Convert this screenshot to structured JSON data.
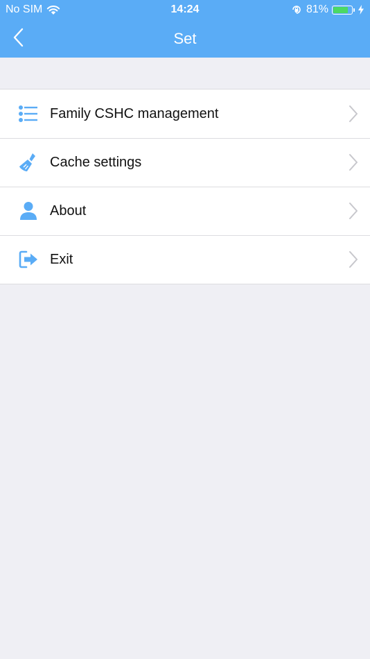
{
  "status_bar": {
    "carrier": "No SIM",
    "time": "14:24",
    "battery_percent": "81%",
    "battery_level": 0.81,
    "icons": [
      "wifi-icon",
      "orientation-lock-icon",
      "battery-icon",
      "charging-icon"
    ]
  },
  "nav": {
    "title": "Set",
    "back_icon": "chevron-left-icon"
  },
  "menu": {
    "items": [
      {
        "label": "Family CSHC management",
        "icon": "list-icon"
      },
      {
        "label": "Cache settings",
        "icon": "brush-icon"
      },
      {
        "label": "About",
        "icon": "user-icon"
      },
      {
        "label": "Exit",
        "icon": "exit-icon"
      }
    ]
  },
  "colors": {
    "header_bg": "#5aacf6",
    "icon_color": "#5aacf6",
    "page_bg": "#efeff4",
    "battery_fill": "#4cd964"
  }
}
